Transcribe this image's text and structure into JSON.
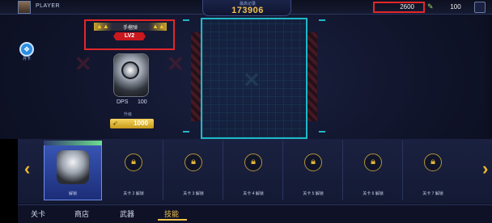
{
  "topbar": {
    "player_name": "PLAYER",
    "score_label": "最高记录",
    "score": "173906",
    "gold": "2600",
    "gems": "100"
  },
  "left_icon": {
    "label": "月卡",
    "icon": "gift-icon"
  },
  "weapon": {
    "name": "手榴弹",
    "level": "LV2",
    "dps_label": "DPS",
    "dps_value": "100",
    "cost_label": "升级",
    "cost_value": "1000"
  },
  "carousel": {
    "selected_label": "解锁",
    "locked_slots": [
      {
        "label": "关卡 2 解锁"
      },
      {
        "label": "关卡 3 解锁"
      },
      {
        "label": "关卡 4 解锁"
      },
      {
        "label": "关卡 5 解锁"
      },
      {
        "label": "关卡 6 解锁"
      },
      {
        "label": "关卡 7 解锁"
      }
    ]
  },
  "nav": {
    "tabs": [
      {
        "label": "关卡"
      },
      {
        "label": "商店"
      },
      {
        "label": "武器"
      },
      {
        "label": "技能",
        "active": true
      }
    ]
  },
  "colors": {
    "accent": "#f2c14e",
    "highlight": "#e3262a",
    "cyan": "#1fb8c8"
  }
}
